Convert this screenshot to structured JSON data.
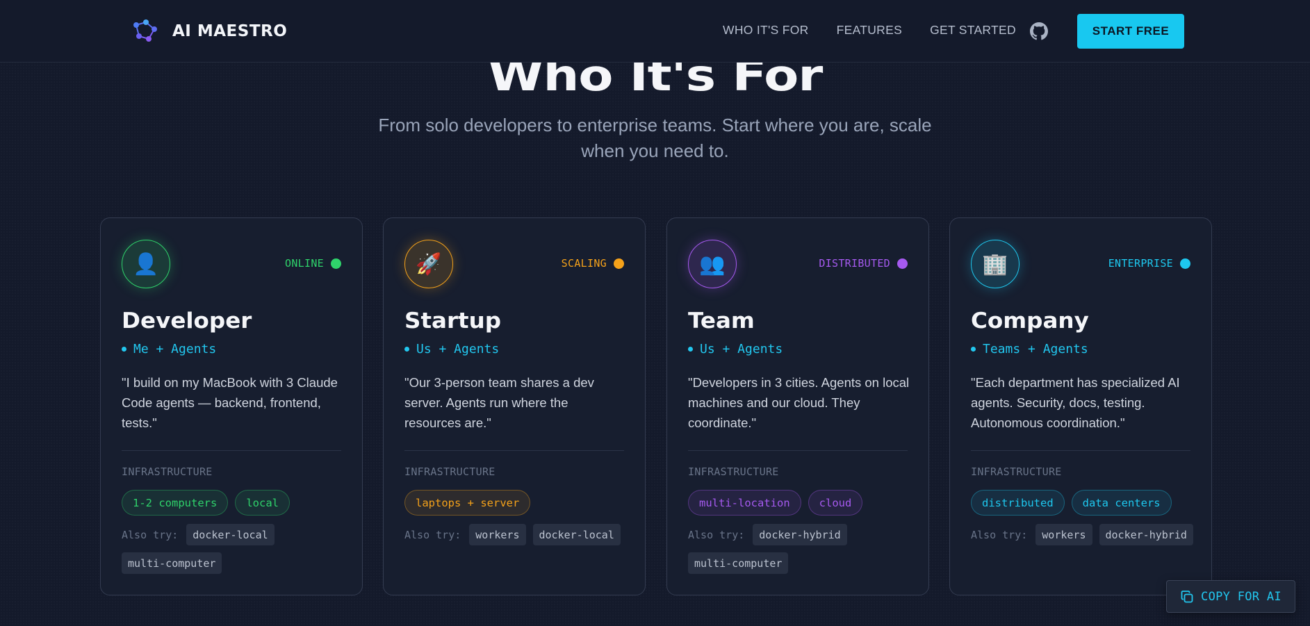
{
  "nav": {
    "brand": "AI MAESTRO",
    "links": [
      "WHO IT'S FOR",
      "FEATURES",
      "GET STARTED"
    ],
    "github_icon": "github-icon",
    "cta": "START FREE"
  },
  "hero": {
    "title": "Who It's For",
    "subtitle": "From solo developers to enterprise teams. Start where you are, scale when you need to."
  },
  "cards": [
    {
      "icon": "👤",
      "status": "ONLINE",
      "accent": "#2fd36b",
      "title": "Developer",
      "tagline": "Me + Agents",
      "quote": "\"I build on my MacBook with 3 Claude Code agents — backend, frontend, tests.\"",
      "infra_label": "INFRASTRUCTURE",
      "pills": [
        "1-2 computers",
        "local"
      ],
      "also_label": "Also try:",
      "also": [
        "docker-local",
        "multi-computer"
      ]
    },
    {
      "icon": "🚀",
      "status": "SCALING",
      "accent": "#f5a21a",
      "title": "Startup",
      "tagline": "Us + Agents",
      "quote": "\"Our 3-person team shares a dev server. Agents run where the resources are.\"",
      "infra_label": "INFRASTRUCTURE",
      "pills": [
        "laptops + server"
      ],
      "also_label": "Also try:",
      "also": [
        "workers",
        "docker-local"
      ]
    },
    {
      "icon": "👥",
      "status": "DISTRIBUTED",
      "accent": "#a65af0",
      "title": "Team",
      "tagline": "Us + Agents",
      "quote": "\"Developers in 3 cities. Agents on local machines and our cloud. They coordinate.\"",
      "infra_label": "INFRASTRUCTURE",
      "pills": [
        "multi-location",
        "cloud"
      ],
      "also_label": "Also try:",
      "also": [
        "docker-hybrid",
        "multi-computer"
      ]
    },
    {
      "icon": "🏢",
      "status": "ENTERPRISE",
      "accent": "#1ec8ef",
      "title": "Company",
      "tagline": "Teams + Agents",
      "quote": "\"Each department has specialized AI agents. Security, docs, testing. Autonomous coordination.\"",
      "infra_label": "INFRASTRUCTURE",
      "pills": [
        "distributed",
        "data centers"
      ],
      "also_label": "Also try:",
      "also": [
        "workers",
        "docker-hybrid"
      ]
    }
  ],
  "copy_button": "COPY FOR AI"
}
